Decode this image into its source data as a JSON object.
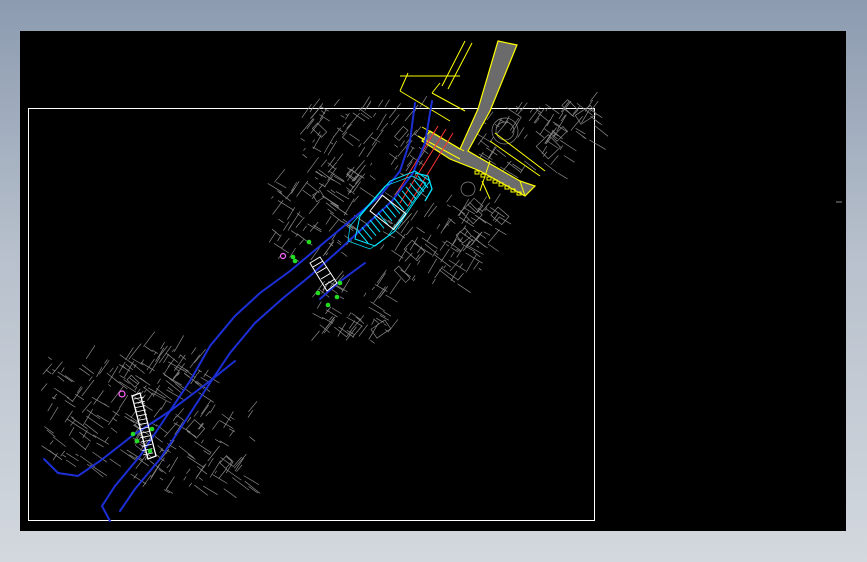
{
  "drawing": {
    "colors": {
      "background": "#000000",
      "frame": "#ffffff",
      "context_lines": "#8a8a8a",
      "alignment": "#1c2fd6",
      "station": "#00e5ff",
      "highway": "#ffff00",
      "highway_fill": "#6b6b6b",
      "markers": "#22dd22",
      "red_lines": "#ff3333",
      "magenta_marker": "#ff66ff"
    },
    "icons": {
      "marker_points": "green-dot-marker",
      "callout": "magenta-circle-marker"
    }
  }
}
